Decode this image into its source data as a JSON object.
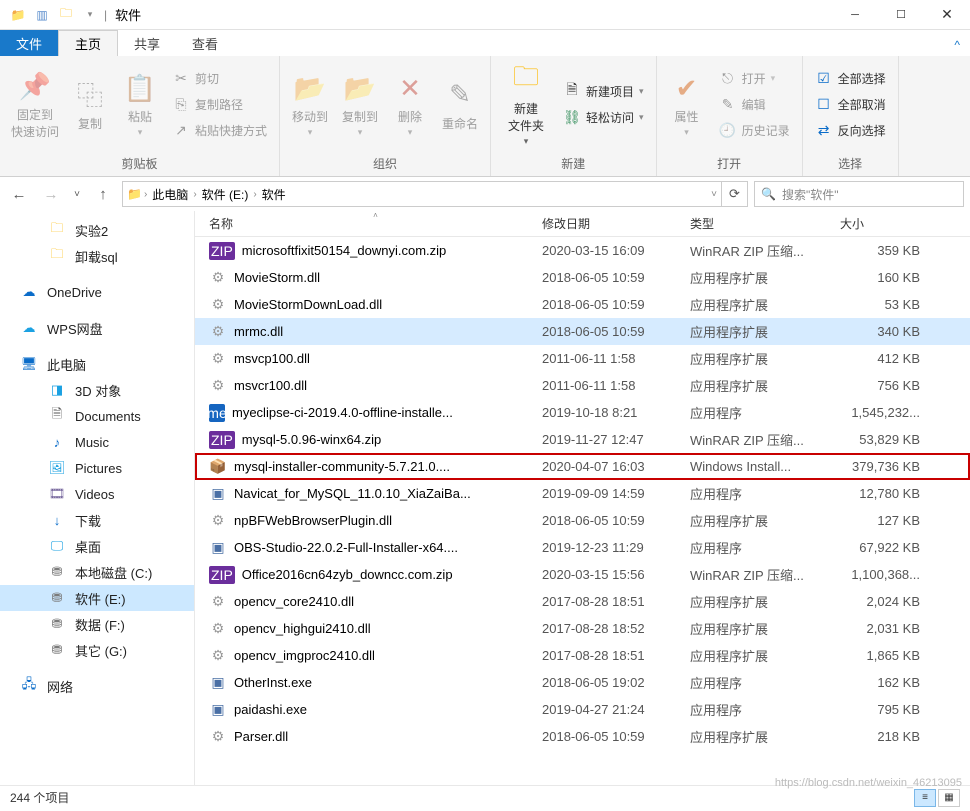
{
  "titlebar": {
    "title": "软件"
  },
  "tabs": {
    "file": "文件",
    "home": "主页",
    "share": "共享",
    "view": "查看"
  },
  "ribbon": {
    "clipboard": {
      "label": "剪贴板",
      "pin": "固定到\n快速访问",
      "copy": "复制",
      "paste": "粘贴",
      "cut": "剪切",
      "copypath": "复制路径",
      "shortcut": "粘贴快捷方式"
    },
    "organize": {
      "label": "组织",
      "moveto": "移动到",
      "copyto": "复制到",
      "delete": "删除",
      "rename": "重命名"
    },
    "new_group": {
      "label": "新建",
      "newfolder": "新建\n文件夹",
      "newitem": "新建项目",
      "easyaccess": "轻松访问"
    },
    "open_group": {
      "label": "打开",
      "properties": "属性",
      "open": "打开",
      "edit": "编辑",
      "history": "历史记录"
    },
    "select_group": {
      "label": "选择",
      "all": "全部选择",
      "none": "全部取消",
      "invert": "反向选择"
    }
  },
  "path": {
    "this_pc": "此电脑",
    "drive": "软件 (E:)",
    "folder": "软件"
  },
  "search": {
    "placeholder": "搜索\"软件\""
  },
  "sidebar": {
    "lab": "实验2",
    "uninstall": "卸载sql",
    "onedrive": "OneDrive",
    "wps": "WPS网盘",
    "thispc": "此电脑",
    "obj3d": "3D 对象",
    "docs": "Documents",
    "music": "Music",
    "pics": "Pictures",
    "videos": "Videos",
    "downloads": "下载",
    "desktop": "桌面",
    "diskC": "本地磁盘 (C:)",
    "diskE": "软件 (E:)",
    "diskF": "数据 (F:)",
    "diskG": "其它 (G:)",
    "network": "网络"
  },
  "columns": {
    "name": "名称",
    "date": "修改日期",
    "type": "类型",
    "size": "大小"
  },
  "files": [
    {
      "icon": "zip",
      "name": "microsoftfixit50154_downyi.com.zip",
      "date": "2020-03-15 16:09",
      "type": "WinRAR ZIP 压缩...",
      "size": "359 KB"
    },
    {
      "icon": "dll",
      "name": "MovieStorm.dll",
      "date": "2018-06-05 10:59",
      "type": "应用程序扩展",
      "size": "160 KB"
    },
    {
      "icon": "dll",
      "name": "MovieStormDownLoad.dll",
      "date": "2018-06-05 10:59",
      "type": "应用程序扩展",
      "size": "53 KB"
    },
    {
      "icon": "dll",
      "name": "mrmc.dll",
      "date": "2018-06-05 10:59",
      "type": "应用程序扩展",
      "size": "340 KB",
      "selected": true
    },
    {
      "icon": "dll",
      "name": "msvcp100.dll",
      "date": "2011-06-11 1:58",
      "type": "应用程序扩展",
      "size": "412 KB"
    },
    {
      "icon": "dll",
      "name": "msvcr100.dll",
      "date": "2011-06-11 1:58",
      "type": "应用程序扩展",
      "size": "756 KB"
    },
    {
      "icon": "me",
      "name": "myeclipse-ci-2019.4.0-offline-installe...",
      "date": "2019-10-18 8:21",
      "type": "应用程序",
      "size": "1,545,232..."
    },
    {
      "icon": "zip",
      "name": "mysql-5.0.96-winx64.zip",
      "date": "2019-11-27 12:47",
      "type": "WinRAR ZIP 压缩...",
      "size": "53,829 KB"
    },
    {
      "icon": "msi",
      "name": "mysql-installer-community-5.7.21.0....",
      "date": "2020-04-07 16:03",
      "type": "Windows Install...",
      "size": "379,736 KB",
      "highlighted": true
    },
    {
      "icon": "exe",
      "name": "Navicat_for_MySQL_11.0.10_XiaZaiBa...",
      "date": "2019-09-09 14:59",
      "type": "应用程序",
      "size": "12,780 KB"
    },
    {
      "icon": "dll",
      "name": "npBFWebBrowserPlugin.dll",
      "date": "2018-06-05 10:59",
      "type": "应用程序扩展",
      "size": "127 KB"
    },
    {
      "icon": "exe",
      "name": "OBS-Studio-22.0.2-Full-Installer-x64....",
      "date": "2019-12-23 11:29",
      "type": "应用程序",
      "size": "67,922 KB"
    },
    {
      "icon": "zip",
      "name": "Office2016cn64zyb_downcc.com.zip",
      "date": "2020-03-15 15:56",
      "type": "WinRAR ZIP 压缩...",
      "size": "1,100,368..."
    },
    {
      "icon": "dll",
      "name": "opencv_core2410.dll",
      "date": "2017-08-28 18:51",
      "type": "应用程序扩展",
      "size": "2,024 KB"
    },
    {
      "icon": "dll",
      "name": "opencv_highgui2410.dll",
      "date": "2017-08-28 18:52",
      "type": "应用程序扩展",
      "size": "2,031 KB"
    },
    {
      "icon": "dll",
      "name": "opencv_imgproc2410.dll",
      "date": "2017-08-28 18:51",
      "type": "应用程序扩展",
      "size": "1,865 KB"
    },
    {
      "icon": "exe",
      "name": "OtherInst.exe",
      "date": "2018-06-05 19:02",
      "type": "应用程序",
      "size": "162 KB"
    },
    {
      "icon": "exe",
      "name": "paidashi.exe",
      "date": "2019-04-27 21:24",
      "type": "应用程序",
      "size": "795 KB"
    },
    {
      "icon": "dll",
      "name": "Parser.dll",
      "date": "2018-06-05 10:59",
      "type": "应用程序扩展",
      "size": "218 KB"
    }
  ],
  "status": {
    "count": "244 个项目"
  },
  "watermark": "https://blog.csdn.net/weixin_46213095"
}
